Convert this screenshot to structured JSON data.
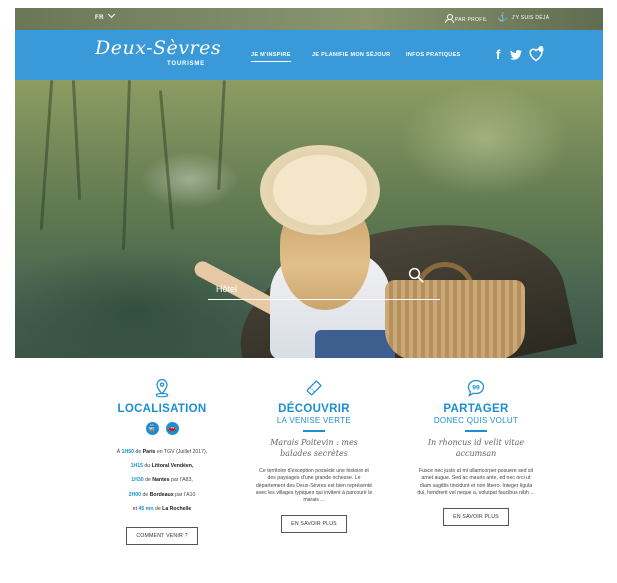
{
  "topbar": {
    "lang": "FR",
    "profil": "PAR PROFIL",
    "jysuis": "J'Y SUIS DÉJÀ"
  },
  "logo": {
    "script": "Deux-Sèvres",
    "sub": "TOURISME"
  },
  "nav": {
    "item1": "JE M'INSPIRE",
    "item2": "JE PLANIFIE MON SÉJOUR",
    "item3": "INFOS PRATIQUES",
    "facebook": "f",
    "twitter": "𝕥",
    "fav_count": "0"
  },
  "search": {
    "placeholder": "Hôtel"
  },
  "columns": {
    "localisation": {
      "title": "LOCALISATION",
      "lines": [
        {
          "pre": "À ",
          "hl": "1H50",
          "mid": " de ",
          "b": "Paris",
          "post": " en TGV (Juillet 2017),"
        },
        {
          "pre": "",
          "hl": "1H15",
          "mid": " du ",
          "b": "Littoral Vendéen,",
          "post": ""
        },
        {
          "pre": "",
          "hl": "1H30",
          "mid": " de ",
          "b": "Nantes",
          "post": " par l'A83,"
        },
        {
          "pre": "",
          "hl": "2H00",
          "mid": " de ",
          "b": "Bordeaux",
          "post": " par l'A10"
        },
        {
          "pre": "et ",
          "hl": "45 mn",
          "mid": " de ",
          "b": "La Rochelle",
          "post": ""
        }
      ],
      "button": "COMMENT VENIR ?"
    },
    "decouvrir": {
      "title": "DÉCOUVRIR",
      "subtitle": "LA VENISE VERTE",
      "italic": "Marais Poitevin : mes balades secrètes",
      "desc": "Ce territoire d'exception possède une histoire et des paysages d'une grande richesse. Le département des Deux-Sèvres est bien représenté avec les villages typiques qui invitent à parcourir le marais ...",
      "button": "EN SAVOIR PLUS"
    },
    "partager": {
      "title": "PARTAGER",
      "subtitle": "DONEC QUIS VOLUT",
      "italic": "In rhoncus id velit vitae accumsan",
      "desc": "Fusce nec justo at mi ullamcorper posuere sed sit amet augue. Sed ac mauris ante, ed nec orci ut diam sagittis tincidunt et non libero. Integer ligula dui, hendrerit vel neque a, volutpat faucibus nibh ...",
      "button": "EN SAVOIR PLUS"
    }
  },
  "colors": {
    "brand_blue": "#3a9ad9",
    "accent_blue": "#1c8fd3"
  }
}
